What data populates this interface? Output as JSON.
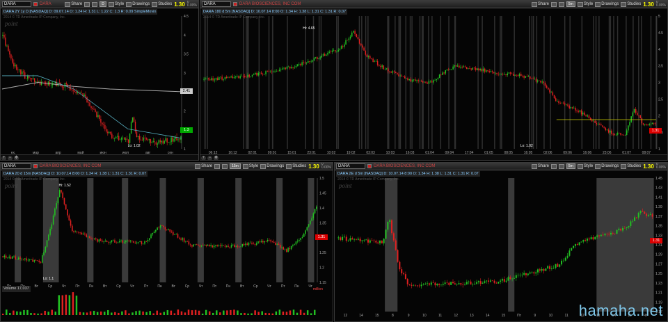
{
  "panels": [
    {
      "symbol": "DARA",
      "company": "DARA",
      "info": "DARA 2Y 1y D [NASDAQ]  D: 09.07.14  O: 1.24  H: 1.31  L: 1.22  C: 1.3  R: 0.09  SimpleMovin",
      "tf": "D",
      "price": "1.30",
      "chg_top": "0",
      "chg_bot": "0.00%",
      "license": "2014 © TD Ameritrade IP Company, Inc.",
      "tags": [
        "2.41",
        "1.3"
      ],
      "annotations": [
        "Lo: 1.02"
      ],
      "xlabels": [
        "ex.",
        "мар",
        "апр",
        "май",
        "июн",
        "июл",
        "авг",
        "сен"
      ]
    },
    {
      "symbol": "DARA",
      "company": "DARA BIOSCIENCES, INC COM",
      "info": "DARA 180 d 5m [NASDAQ]  D: 10.07.14 8:00  O: 1.34  H: 1.38  L: 1.31  C: 1.31  R: 0.07",
      "tf": "5m",
      "price": "1.30",
      "chg_top": "0",
      "chg_bot": "0.00%",
      "license": "2014 © TD Ameritrade IP Company, Inc.",
      "tags": [
        "1.31"
      ],
      "annotations": [
        "Hi: 4.65",
        "Lo: 1.02"
      ],
      "xlabels": [
        "06:12",
        "16:12",
        "02:01",
        "09:01",
        "15:01",
        "23:01",
        "10:02",
        "19:02",
        "03:03",
        "10:03",
        "16:03",
        "01:04",
        "09:04",
        "17:04",
        "01:05",
        "08:05",
        "16:05",
        "02:06",
        "09:06",
        "16:06",
        "23:06",
        "01:07",
        "08:07"
      ]
    },
    {
      "symbol": "DARA",
      "company": "DARA BIOSCIENCES, INC COM",
      "info": "DARA 20 d 15m [NASDAQ]  D: 10.07.14 8:00  O: 1.34  H: 1.38  L: 1.31  C: 1.31  R: 0.07",
      "tf": "15m",
      "price": "1.30",
      "chg_top": "0",
      "chg_bot": "0.00%",
      "license": "2014 © TD Ameritrade IP Company, Inc.",
      "tags": [
        "1.31"
      ],
      "annotations": [
        "Hi: 1.52",
        "Lo: 1.1"
      ],
      "volume_label": "Volume  17,037",
      "volume_unit": "million",
      "xlabels": [
        "Пт",
        "Пн",
        "Вт",
        "Ср",
        "Чт",
        "Пт",
        "Пн",
        "Вт",
        "Ср",
        "Чт",
        "Пт",
        "Пн",
        "Вт",
        "Ср",
        "Чт",
        "Пт",
        "Пн",
        "Вт",
        "Ср",
        "Чт",
        "Пт",
        "Пн",
        "Чт"
      ]
    },
    {
      "symbol": "DARA",
      "company": "DARA BIOSCIENCES, INC COM",
      "info": "DARA 2E d 5m [NASDAQ]  D: 10.07.14 8:00  O: 1.34  H: 1.38  L: 1.31  C: 1.31  R: 0.07",
      "tf": "5m",
      "price": "1.30",
      "chg_top": "0",
      "chg_bot": "0.00%",
      "license": "2014 © TD Ameritrade IP Company, Inc.",
      "tags": [
        "1.31"
      ],
      "xlabels": [
        "12",
        "14",
        "15",
        "8",
        "9",
        "10",
        "11",
        "12",
        "13",
        "14",
        "15",
        "Пт",
        "9",
        "10",
        "11",
        "12",
        "13",
        "14",
        "15",
        "Чт"
      ]
    }
  ],
  "toolbar": {
    "share": "Share",
    "style": "Style",
    "drawings": "Drawings",
    "studies": "Studies"
  },
  "watermark": "hamaha.net",
  "logo": "point",
  "colors": {
    "up": "#22c022",
    "down": "#e02020",
    "session_shade": "#3a3a3a",
    "price_tag": "#d00000",
    "accent": "#ffff00"
  }
}
